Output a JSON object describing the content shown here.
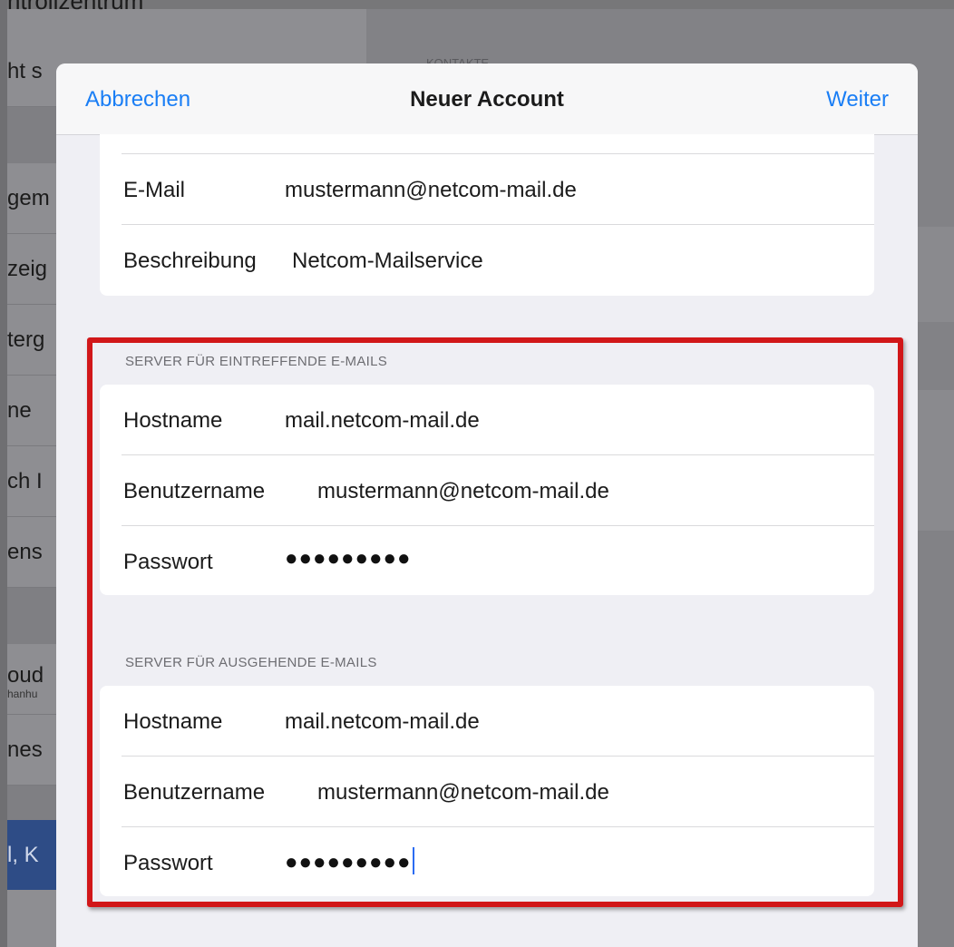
{
  "background": {
    "top_title": "ntrollzentrum",
    "right_section_label": "KONTAKTE",
    "sidebar_fragments": [
      "ht s",
      "gem",
      "zeig",
      "terg",
      "ne",
      "ch I",
      "ens",
      "oud",
      "nes",
      "l, K"
    ],
    "sidebar_sub_fragment": "hanhu"
  },
  "navbar": {
    "cancel_label": "Abbrechen",
    "title": "Neuer Account",
    "next_label": "Weiter"
  },
  "account": {
    "email_label": "E-Mail",
    "email_value": "mustermann@netcom-mail.de",
    "description_label": "Beschreibung",
    "description_value": "Netcom-Mailservice"
  },
  "incoming": {
    "header": "SERVER FÜR EINTREFFENDE E-MAILS",
    "hostname_label": "Hostname",
    "hostname_value": "mail.netcom-mail.de",
    "username_label": "Benutzername",
    "username_value": "mustermann@netcom-mail.de",
    "password_label": "Passwort",
    "password_value": "●●●●●●●●●"
  },
  "outgoing": {
    "header": "SERVER FÜR AUSGEHENDE E-MAILS",
    "hostname_label": "Hostname",
    "hostname_value": "mail.netcom-mail.de",
    "username_label": "Benutzername",
    "username_value": "mustermann@netcom-mail.de",
    "password_label": "Passwort",
    "password_value": "●●●●●●●●●"
  },
  "colors": {
    "accent": "#1a7ef5",
    "highlight_border": "#d11719",
    "modal_background": "#efeff4"
  }
}
